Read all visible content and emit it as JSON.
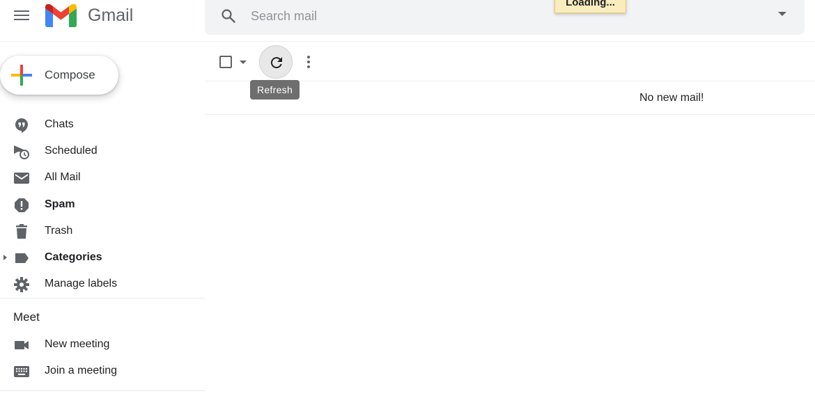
{
  "app": {
    "name": "Gmail",
    "logo_colors": {
      "blue": "#4285f4",
      "red": "#ea4335",
      "yellow": "#fbbc04",
      "green": "#34a853",
      "dark_red": "#c5221f"
    }
  },
  "header": {
    "menu_icon": "hamburger-menu-icon",
    "search": {
      "placeholder": "Search mail",
      "value": "",
      "icon": "search-icon",
      "options_icon": "caret-down-icon"
    },
    "loading_notice": "Loading..."
  },
  "compose": {
    "label": "Compose",
    "icon": "plus-multicolor-icon"
  },
  "sidebar": {
    "items": [
      {
        "label": "Chats",
        "icon": "chat-bubble-icon",
        "bold": false
      },
      {
        "label": "Scheduled",
        "icon": "scheduled-send-icon",
        "bold": false
      },
      {
        "label": "All Mail",
        "icon": "envelope-icon",
        "bold": false
      },
      {
        "label": "Spam",
        "icon": "spam-report-icon",
        "bold": true
      },
      {
        "label": "Trash",
        "icon": "trash-icon",
        "bold": false
      },
      {
        "label": "Categories",
        "icon": "label-tag-icon",
        "bold": true,
        "expandable": true
      },
      {
        "label": "Manage labels",
        "icon": "gear-icon",
        "bold": false
      }
    ],
    "meet": {
      "title": "Meet",
      "items": [
        {
          "label": "New meeting",
          "icon": "video-camera-icon"
        },
        {
          "label": "Join a meeting",
          "icon": "keyboard-icon"
        }
      ]
    }
  },
  "toolbar": {
    "select_all_checked": false,
    "refresh_tooltip": "Refresh",
    "more_icon": "more-vertical-icon"
  },
  "message_list": {
    "empty_message": "No new mail!"
  }
}
